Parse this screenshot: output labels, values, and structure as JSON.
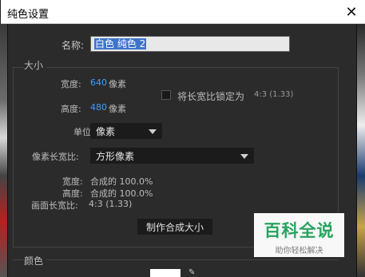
{
  "dialog": {
    "title": "纯色设置",
    "close_glyph": "✕"
  },
  "name": {
    "label": "名称:",
    "value": "白色 纯色 2"
  },
  "size_section": {
    "title": "大小",
    "width_label": "宽度:",
    "width_value": "640",
    "width_unit": "像素",
    "height_label": "高度:",
    "height_value": "480",
    "height_unit": "像素",
    "lock_label": "将长宽比锁定为",
    "lock_ratio": "4:3 (1.33)",
    "lock_checked": false,
    "unit_label": "单位:",
    "unit_value": "像素",
    "pixel_aspect_label": "像素长宽比:",
    "pixel_aspect_value": "方形像素",
    "summary_width_label": "宽度:",
    "summary_width_value": "合成的 100.0%",
    "summary_height_label": "高度:",
    "summary_height_value": "合成的 100.0%",
    "frame_aspect_label": "画面长宽比:",
    "frame_aspect_value": "4:3 (1.33)",
    "make_comp_size_button": "制作合成大小"
  },
  "color_section": {
    "title": "颜色",
    "swatch_color": "#ffffff"
  },
  "watermark": {
    "main": "百科全说",
    "sub": "助你轻松解决"
  }
}
